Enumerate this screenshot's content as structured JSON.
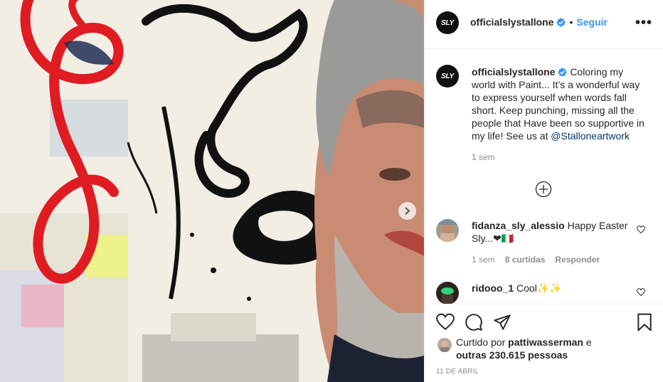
{
  "post": {
    "username": "officialslystallone",
    "avatar_text": "SLY",
    "separator": "•",
    "follow_label": "Seguir",
    "more_label": "•••"
  },
  "caption": {
    "username": "officialslystallone",
    "text": "Coloring my world with Paint... It’s a wonderful way to express yourself when words fall short. Keep punching, missing all the people that Have been so supportive in my life! See us at ",
    "mention": "@Stalloneartwork",
    "time": "1 sem"
  },
  "comments": [
    {
      "username": "fidanza_sly_alessio",
      "text": "Happy Easter Sly...❤🇮🇹",
      "time": "1 sem",
      "likes": "8 curtidas",
      "reply": "Responder"
    },
    {
      "username": "ridooo_1",
      "text": "Cool✨✨"
    }
  ],
  "likes": {
    "prefix": "Curtido por",
    "user": "pattiwasserman",
    "conj": "e",
    "others": "outras 230.615 pessoas"
  },
  "date": "11 DE ABRIL",
  "colors": {
    "accent": "#3897f0",
    "verified": "#3897f0",
    "text": "#262626",
    "muted": "#8e8e8e"
  }
}
